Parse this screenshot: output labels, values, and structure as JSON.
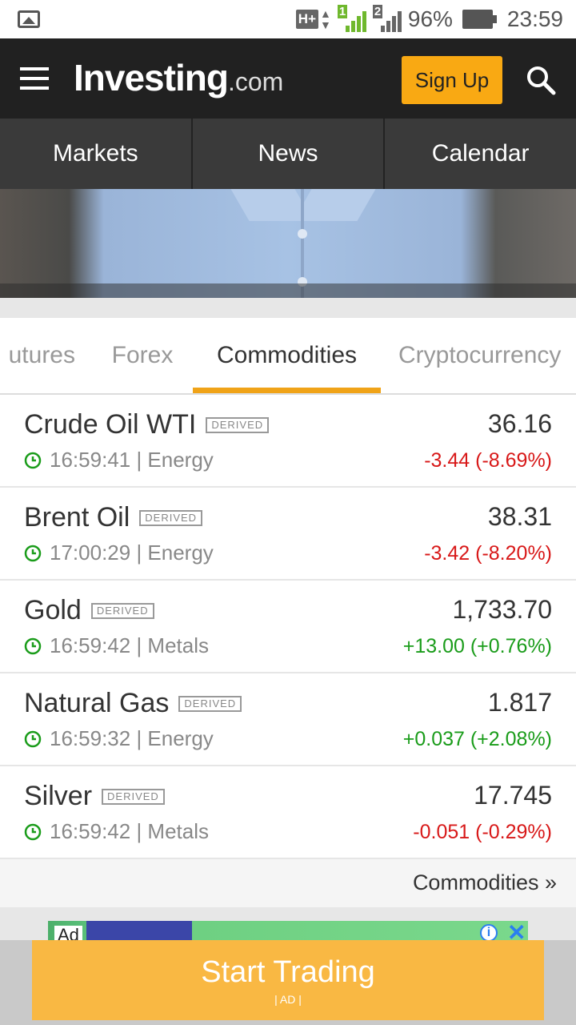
{
  "status_bar": {
    "network_type": "H+",
    "sim1": "1",
    "sim2": "2",
    "battery": "96%",
    "time": "23:59"
  },
  "header": {
    "logo_main": "Investing",
    "logo_tld": ".com",
    "signup_label": "Sign Up"
  },
  "nav": {
    "items": [
      "Markets",
      "News",
      "Calendar"
    ]
  },
  "tabs": {
    "items": [
      "utures",
      "Forex",
      "Commodities",
      "Cryptocurrency"
    ],
    "active": "Commodities"
  },
  "commodities": [
    {
      "name": "Crude Oil WTI",
      "badge": "DERIVED",
      "time": "16:59:41",
      "category": "Energy",
      "price": "36.16",
      "change": "-3.44 (-8.69%)",
      "direction": "down"
    },
    {
      "name": "Brent Oil",
      "badge": "DERIVED",
      "time": "17:00:29",
      "category": "Energy",
      "price": "38.31",
      "change": "-3.42 (-8.20%)",
      "direction": "down"
    },
    {
      "name": "Gold",
      "badge": "DERIVED",
      "time": "16:59:42",
      "category": "Metals",
      "price": "1,733.70",
      "change": "+13.00 (+0.76%)",
      "direction": "up"
    },
    {
      "name": "Natural Gas",
      "badge": "DERIVED",
      "time": "16:59:32",
      "category": "Energy",
      "price": "1.817",
      "change": "+0.037 (+2.08%)",
      "direction": "up"
    },
    {
      "name": "Silver",
      "badge": "DERIVED",
      "time": "16:59:42",
      "category": "Metals",
      "price": "17.745",
      "change": "-0.051 (-0.29%)",
      "direction": "down"
    }
  ],
  "more_link": "Commodities »",
  "ad": {
    "label": "Ad",
    "cta": "Start Trading",
    "cta_sub": "| AD |"
  },
  "colors": {
    "header_bg": "#212121",
    "accent": "#f9a913",
    "down": "#d81818",
    "up": "#1a9c1a"
  }
}
